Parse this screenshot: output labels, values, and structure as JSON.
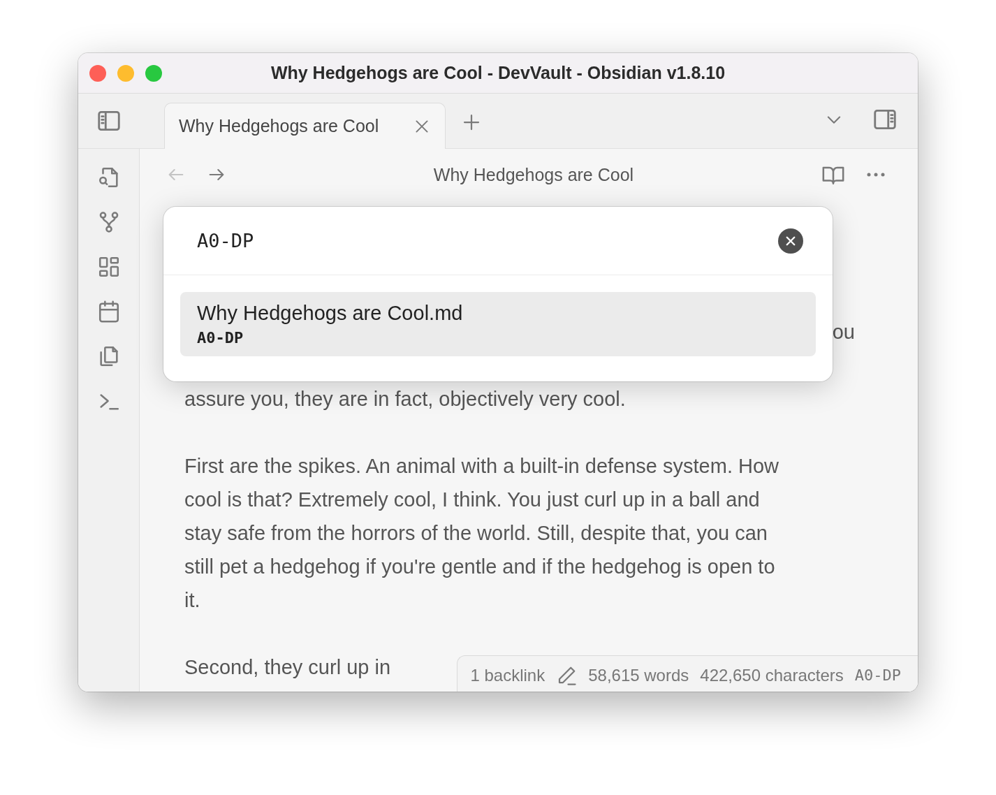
{
  "window": {
    "title": "Why Hedgehogs are Cool - DevVault - Obsidian v1.8.10"
  },
  "tabs": [
    {
      "label": "Why Hedgehogs are Cool",
      "selected": true
    }
  ],
  "editor_header": {
    "back_disabled": true,
    "forward_disabled": false,
    "title": "Why Hedgehogs are Cool"
  },
  "content": {
    "partial_line": "ou",
    "paragraphs": [
      {
        "lines": [
          "assure you, they are in fact, objectively very cool."
        ]
      },
      {
        "lines": [
          "First are the spikes. An animal with a built-in defense system. How",
          "cool is that? Extremely cool, I think. You just curl up in a ball and",
          "stay safe from the horrors of the world. Still, despite that, you can",
          "still pet a hedgehog if you're gentle and if the hedgehog is open to",
          "it."
        ]
      },
      {
        "lines": [
          "Second, they curl up in"
        ]
      }
    ]
  },
  "modal": {
    "query": "A0-DP",
    "results": [
      {
        "title": "Why Hedgehogs are Cool.md",
        "match": "A0-DP",
        "selected": true
      }
    ]
  },
  "status_bar": {
    "backlinks": "1 backlink",
    "words": "58,615 words",
    "characters": "422,650 characters",
    "code": "A0-DP"
  }
}
